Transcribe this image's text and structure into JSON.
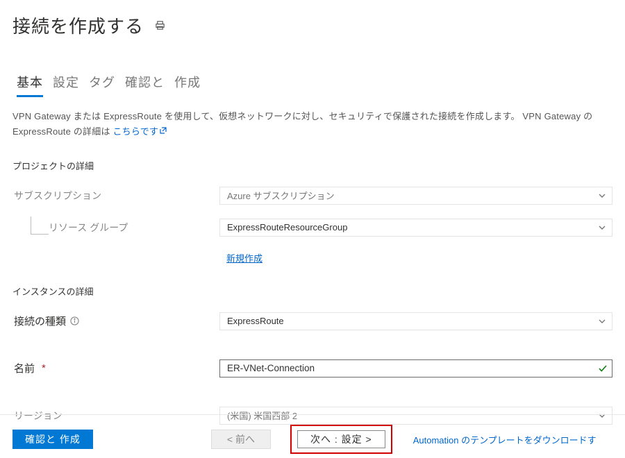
{
  "header": {
    "title": "接続を作成する"
  },
  "tabs": {
    "basic": "基本",
    "settings": "設定",
    "tags": "タグ",
    "review": "確認と",
    "create_suffix": "作成"
  },
  "description": {
    "text_prefix": "VPN Gateway または ExpressRoute を使用して、仮想ネットワークに対し、セキュリティで保護された接続を作成します。",
    "text_link_lead": "VPN Gateway の ExpressRoute の詳細は",
    "link_text": "こちらです"
  },
  "project_section": {
    "title": "プロジェクトの詳細",
    "subscription_label": "サブスクリプション",
    "subscription_value": "Azure サブスクリプション",
    "resource_group_label": "リソース グループ",
    "resource_group_value": "ExpressRouteResourceGroup",
    "new_link": "新規作成"
  },
  "instance_section": {
    "title": "インスタンスの詳細",
    "conn_type_label": "接続の種類",
    "conn_type_value": "ExpressRoute",
    "name_label": "名前",
    "name_value": "ER-VNet-Connection",
    "region_label": "リージョン",
    "region_value": "(米国) 米国西部 2"
  },
  "footer": {
    "review_create": "確認と 作成",
    "prev": "< 前へ",
    "next": "次へ : 設定 >",
    "automation_link": "Automation のテンプレートをダウンロードす"
  }
}
